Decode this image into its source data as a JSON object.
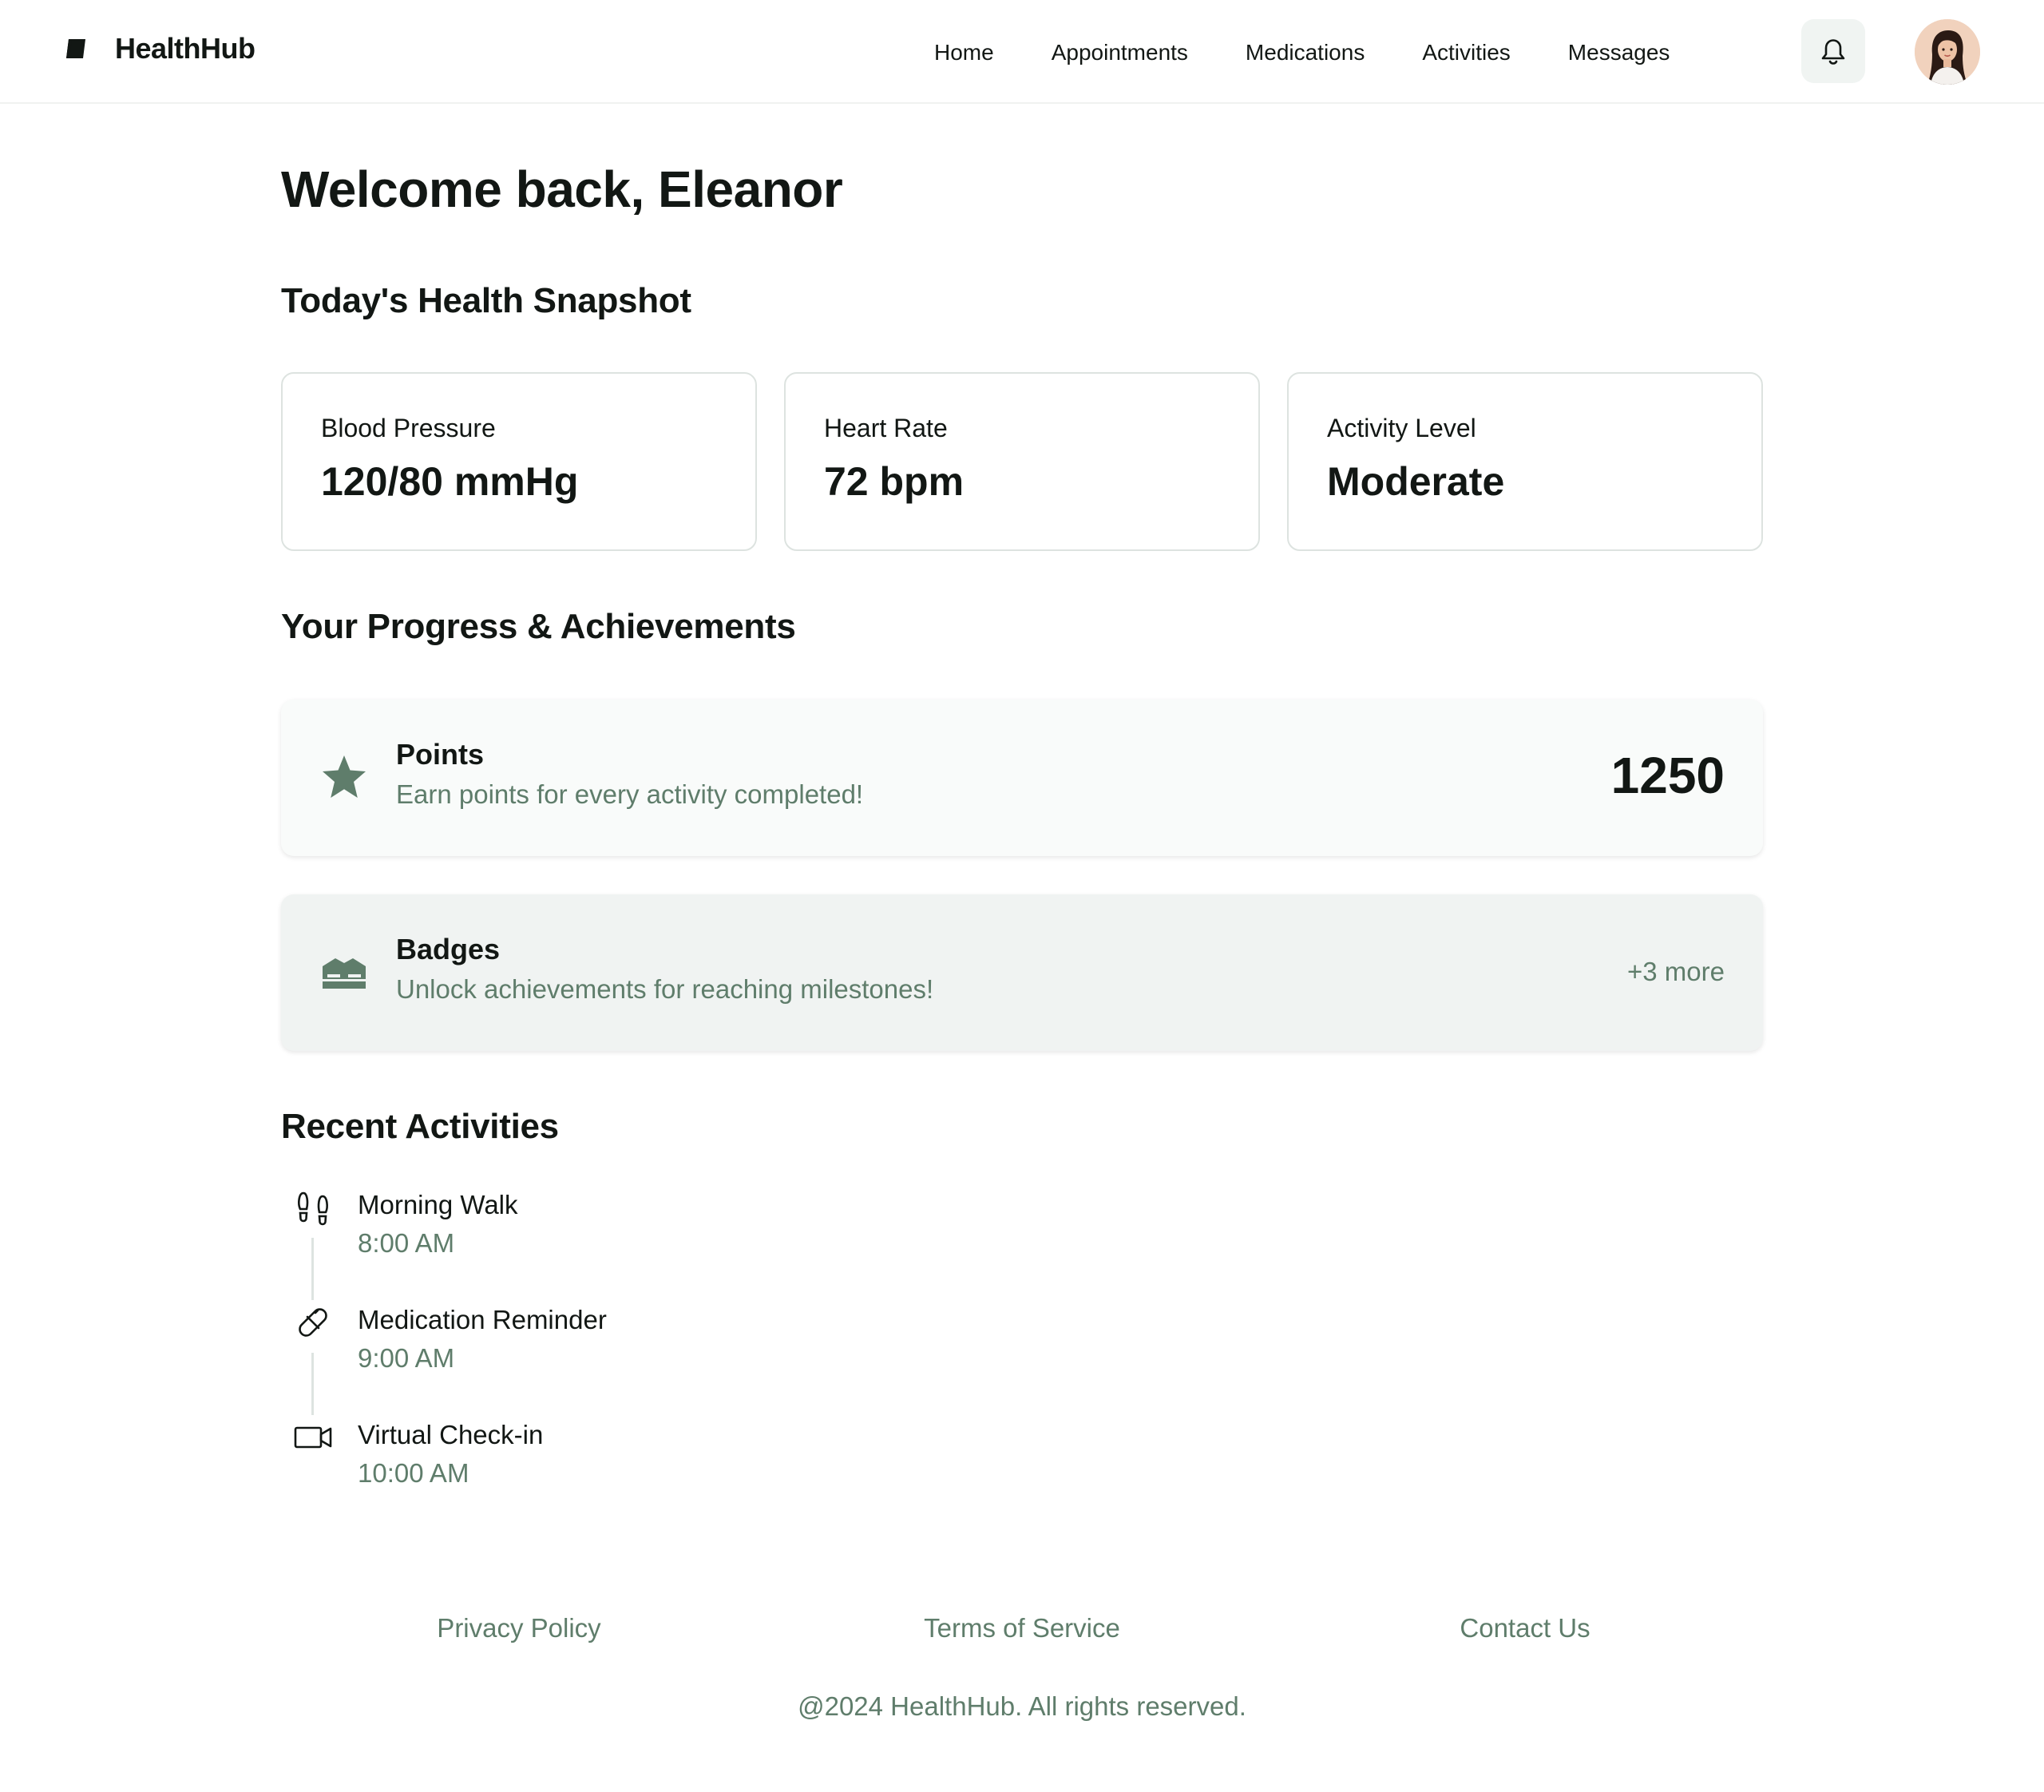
{
  "brand": {
    "name": "HealthHub",
    "icon": "healthhub-logo-icon"
  },
  "nav": {
    "items": [
      {
        "label": "Home"
      },
      {
        "label": "Appointments"
      },
      {
        "label": "Medications"
      },
      {
        "label": "Activities"
      },
      {
        "label": "Messages"
      }
    ],
    "notifications_icon": "bell-icon",
    "avatar": "user-avatar"
  },
  "main": {
    "welcome": "Welcome back, Eleanor",
    "snapshot_title": "Today's Health Snapshot",
    "stats": [
      {
        "label": "Blood Pressure",
        "value": "120/80 mmHg"
      },
      {
        "label": "Heart Rate",
        "value": "72 bpm"
      },
      {
        "label": "Activity Level",
        "value": "Moderate"
      }
    ],
    "progress_title": "Your Progress & Achievements",
    "points": {
      "icon": "star-icon",
      "title": "Points",
      "description": "Earn points for every activity completed!",
      "value": "1250"
    },
    "badges": {
      "icon": "badge-icon",
      "title": "Badges",
      "description": "Unlock achievements for reaching milestones!",
      "more": "+3 more"
    },
    "activities_title": "Recent Activities",
    "activities": [
      {
        "icon": "footprints-icon",
        "title": "Morning Walk",
        "time": "8:00 AM"
      },
      {
        "icon": "pill-icon",
        "title": "Medication Reminder",
        "time": "9:00 AM"
      },
      {
        "icon": "video-camera-icon",
        "title": "Virtual Check-in",
        "time": "10:00 AM"
      }
    ]
  },
  "footer": {
    "links": [
      {
        "label": "Privacy Policy"
      },
      {
        "label": "Terms of Service"
      },
      {
        "label": "Contact Us"
      }
    ],
    "copyright": "@2024 HealthHub. All rights reserved."
  },
  "colors": {
    "accent": "#5f7d6b",
    "text": "#121714",
    "border": "#dde3e0",
    "badge_card_bg": "#f0f3f2",
    "points_card_bg": "#f9fbfa"
  }
}
